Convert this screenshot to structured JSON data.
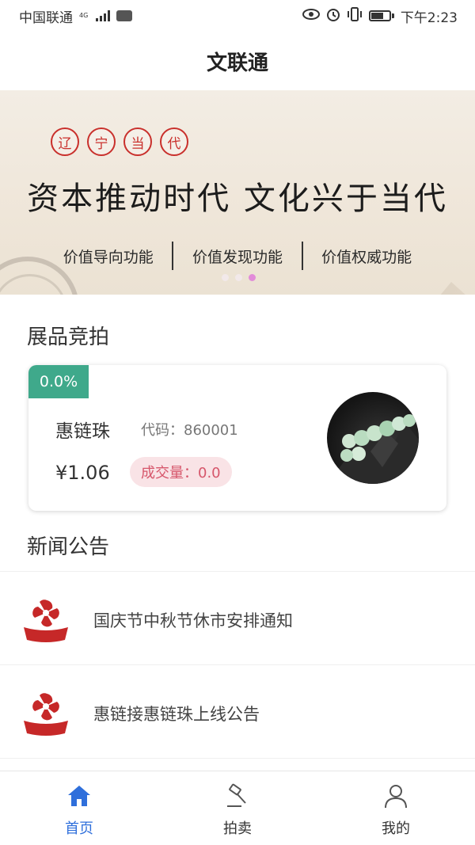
{
  "status_bar": {
    "carrier": "中国联通",
    "network": "4G",
    "time": "下午2:23"
  },
  "header": {
    "title": "文联通"
  },
  "banner": {
    "seals": [
      "辽",
      "宁",
      "当",
      "代"
    ],
    "slogan": "资本推动时代 文化兴于当代",
    "functions": [
      "价值导向功能",
      "价值发现功能",
      "价值权威功能"
    ],
    "carousel_total": 3,
    "carousel_active": 3
  },
  "auction": {
    "section_title": "展品竞拍",
    "item": {
      "change": "0.0%",
      "name": "惠链珠",
      "code": "代码：860001",
      "price": "¥1.06",
      "volume": "成交量：0.0"
    }
  },
  "news": {
    "section_title": "新闻公告",
    "items": [
      {
        "title": "国庆节中秋节休市安排通知"
      },
      {
        "title": "惠链接惠链珠上线公告"
      }
    ]
  },
  "tabbar": {
    "tabs": [
      {
        "label": "首页",
        "icon": "home-icon",
        "active": true
      },
      {
        "label": "拍卖",
        "icon": "gavel-icon",
        "active": false
      },
      {
        "label": "我的",
        "icon": "user-icon",
        "active": false
      }
    ]
  },
  "colors": {
    "accent": "#2f6fdb",
    "change_tag": "#3fa98b",
    "volume_text": "#d6566b",
    "volume_bg": "#f9e3e6",
    "carousel_active": "#e28bd9",
    "seal_red": "#c9302c"
  }
}
